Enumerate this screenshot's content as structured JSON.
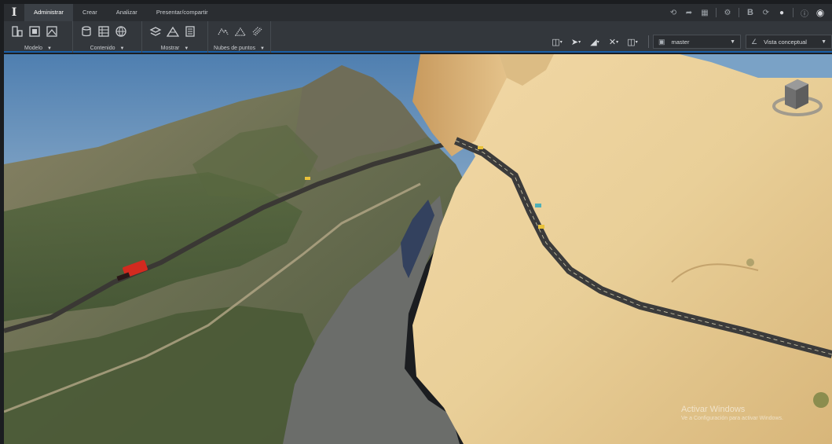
{
  "app": {
    "logo_text": "I"
  },
  "tabs": [
    {
      "label": "Administrar",
      "active": true
    },
    {
      "label": "Crear",
      "active": false
    },
    {
      "label": "Analizar",
      "active": false
    },
    {
      "label": "Presentar/compartir",
      "active": false
    }
  ],
  "top_icons": [
    "undo-icon",
    "share-icon",
    "grid-icon",
    "settings-icon",
    "bim-icon",
    "sync-icon",
    "user-icon",
    "help-icon",
    "account-icon"
  ],
  "ribbon": {
    "groups": [
      {
        "label": "Modelo",
        "icons": [
          "model-icon",
          "layers-icon",
          "terrain-icon"
        ]
      },
      {
        "label": "Contenido",
        "icons": [
          "database-icon",
          "table-icon",
          "globe-icon"
        ]
      },
      {
        "label": "Mostrar",
        "icons": [
          "layers-stack-icon",
          "mountain-icon",
          "list-icon"
        ]
      },
      {
        "label": "Nubes de puntos",
        "icons": [
          "point-cloud-icon",
          "point-mountain-icon",
          "point-layer-icon"
        ]
      }
    ],
    "tools": [
      "monitor-icon",
      "pointer-icon",
      "measure-icon",
      "tools-icon",
      "panel-icon"
    ],
    "scenario_select": {
      "value": "master",
      "icon": "scenario-icon"
    },
    "style_select": {
      "value": "Vista conceptual",
      "icon": "style-icon"
    }
  },
  "colors": {
    "accent": "#1a5fa8",
    "ribbon": "#33373c",
    "topbar": "#2a2d31",
    "sky": "#5b88b6",
    "water": "#6b6d6a",
    "vehicle_red": "#d32a1f"
  },
  "watermark": {
    "title": "Activar Windows",
    "subtitle": "Ve a Configuración para activar Windows."
  }
}
